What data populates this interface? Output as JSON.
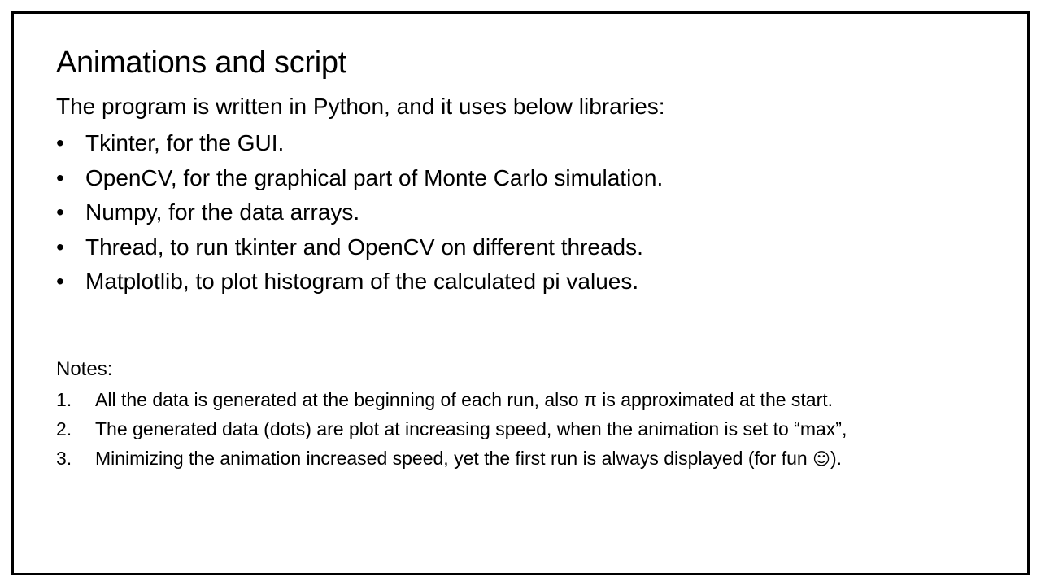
{
  "slide": {
    "title": "Animations and script",
    "intro": "The program is written in Python, and it uses below libraries:",
    "bullet_glyph": "•",
    "bullets": [
      "Tkinter, for the GUI.",
      "OpenCV, for the graphical part of Monte Carlo simulation.",
      "Numpy, for the data arrays.",
      "Thread, to run tkinter and OpenCV on different threads.",
      "Matplotlib, to plot histogram of the calculated pi values."
    ],
    "notes_heading": "Notes:",
    "notes": [
      {
        "number": "1.",
        "text": "All the data is generated at the beginning of each run, also π is approximated at the start."
      },
      {
        "number": "2.",
        "text": "The generated data (dots) are plot at increasing speed, when the animation is set to “max”,"
      },
      {
        "number": "3.",
        "text": "Minimizing the animation increased speed, yet the first run is always displayed (for fun ",
        "emoji": "☺",
        "text_end": ")."
      }
    ]
  }
}
